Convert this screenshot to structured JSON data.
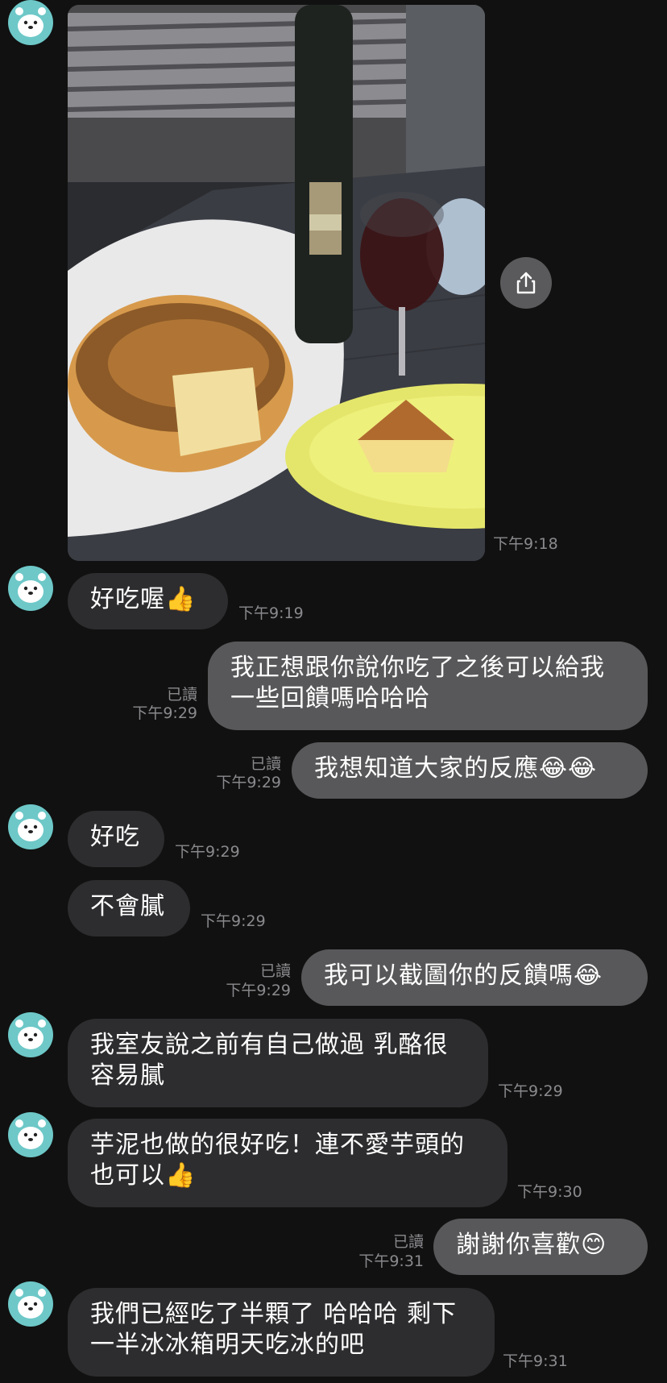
{
  "messages": [
    {
      "id": "m1",
      "type": "image",
      "time": "下午9:18"
    },
    {
      "id": "m2",
      "text": "好吃喔👍",
      "time": "下午9:19"
    },
    {
      "id": "m3",
      "text": "我正想跟你說你吃了之後可以給我\n一些回饋嗎哈哈哈",
      "read": "已讀",
      "time": "下午9:29"
    },
    {
      "id": "m4",
      "text": "我想知道大家的反應😂😂",
      "read": "已讀",
      "time": "下午9:29"
    },
    {
      "id": "m5",
      "text": "好吃",
      "time": "下午9:29"
    },
    {
      "id": "m6",
      "text": "不會膩",
      "time": "下午9:29"
    },
    {
      "id": "m7",
      "text": "我可以截圖你的反饋嗎😂",
      "read": "已讀",
      "time": "下午9:29"
    },
    {
      "id": "m8",
      "text": "我室友說之前有自己做過 乳酪很\n容易膩",
      "time": "下午9:29"
    },
    {
      "id": "m9",
      "text": "芋泥也做的很好吃！連不愛芋頭的\n也可以👍",
      "time": "下午9:30"
    },
    {
      "id": "m10",
      "text": "謝謝你喜歡😊",
      "read": "已讀",
      "time": "下午9:31"
    },
    {
      "id": "m11",
      "text": "我們已經吃了半顆了 哈哈哈 剩下\n一半冰冰箱明天吃冰的吧",
      "time": "下午9:31"
    }
  ],
  "colors": {
    "background": "#111111",
    "incoming_bubble": "#2d2d2f",
    "outgoing_bubble": "#58585a",
    "avatar": "#6ec8c8",
    "timestamp": "#8a8a8e"
  },
  "icons": {
    "avatar": "bear-face-icon",
    "share": "share-upload-icon"
  }
}
